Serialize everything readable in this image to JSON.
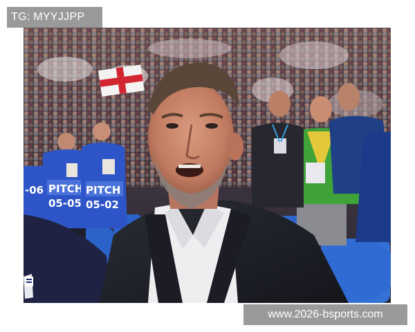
{
  "overlay": {
    "tag_text": "TG: MYYJJPP",
    "watermark_text": "www.2026-bsports.com"
  },
  "photo": {
    "bibs": [
      {
        "top": "PITCH",
        "bottom": "05-05"
      },
      {
        "top": "PITCH",
        "bottom": "05-02"
      },
      {
        "top": "",
        "bottom": "-06"
      }
    ]
  },
  "colors": {
    "label_background": "#9a9a9a",
    "label_text": "#ffffff",
    "page_background": "#ffffff",
    "bib_blue": "#2d55c8",
    "seat_blue": "#2b63c9",
    "steward_green": "#3fa33a"
  }
}
